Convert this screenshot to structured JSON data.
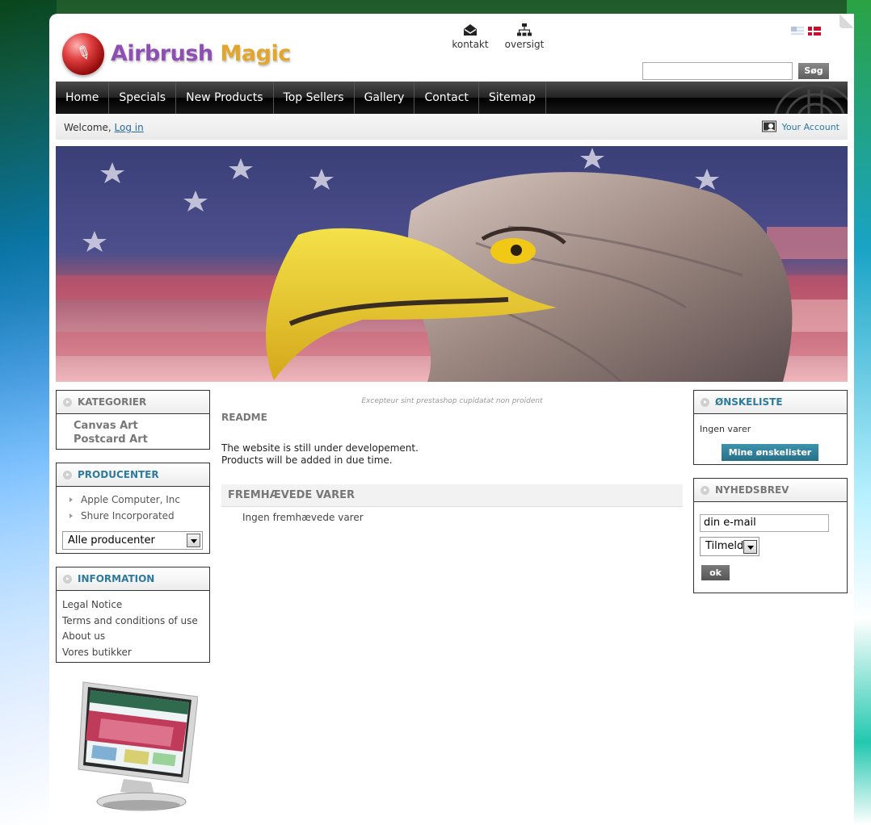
{
  "brand": {
    "name_part1": "Airbrush",
    "name_part2": "Magic"
  },
  "top_links": {
    "contact": "kontakt",
    "sitemap": "oversigt"
  },
  "search": {
    "value": "",
    "button": "Søg"
  },
  "nav": [
    "Home",
    "Specials",
    "New Products",
    "Top Sellers",
    "Gallery",
    "Contact",
    "Sitemap"
  ],
  "welcome": {
    "text": "Welcome,",
    "login": "Log in",
    "account": "Your Account"
  },
  "categories": {
    "title": "KATEGORIER",
    "items": [
      "Canvas Art",
      "Postcard Art"
    ]
  },
  "manufacturers": {
    "title": "PRODUCENTER",
    "items": [
      "Apple Computer, Inc",
      "Shure Incorporated"
    ],
    "select": "Alle producenter"
  },
  "information": {
    "title": "INFORMATION",
    "items": [
      "Legal Notice",
      "Terms and conditions of use",
      "About us",
      "Vores butikker"
    ]
  },
  "center": {
    "tagline": "Excepteur sint prestashop cupidatat non proident",
    "readme_title": "README",
    "readme_line1": "The website is still under developement.",
    "readme_line2": "Products will be added in due time.",
    "featured_title": "FREMHÆVEDE VARER",
    "featured_empty": "Ingen fremhævede varer"
  },
  "wishlist": {
    "title": "ØNSKELISTE",
    "empty": "Ingen varer",
    "button": "Mine ønskelister"
  },
  "newsletter": {
    "title": "NYHEDSBREV",
    "email_value": "din e-mail",
    "select": "Tilmeld",
    "ok": "ok"
  },
  "colors": {
    "accent_blue": "#2e7a9c",
    "nav_bg": "#1a1a1a",
    "heading_gray": "#777777"
  }
}
